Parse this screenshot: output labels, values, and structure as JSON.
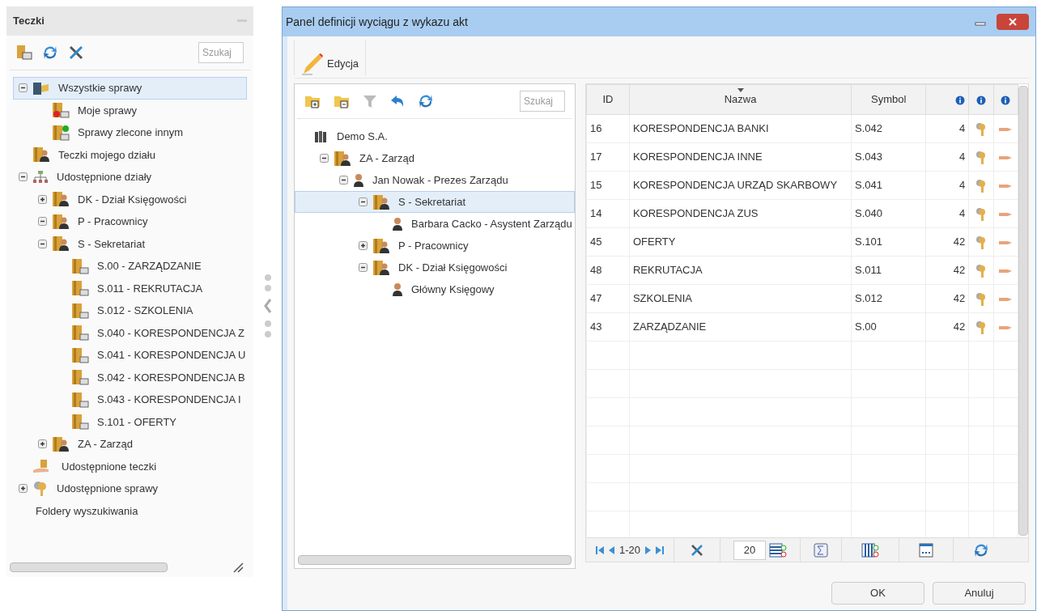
{
  "left_panel": {
    "title": "Teczki",
    "search": {
      "placeholder": "Szukaj"
    },
    "tree": [
      {
        "label": "Wszystkie sprawy",
        "kind": "cabinet",
        "expanded": true,
        "selected": true,
        "children": [
          {
            "label": "Moje sprawy",
            "kind": "case-alert",
            "selected": false
          },
          {
            "label": "Sprawy zlecone innym",
            "kind": "case-add",
            "selected": false
          }
        ]
      },
      {
        "label": "Teczki mojego działu",
        "kind": "dept",
        "selected": false
      },
      {
        "label": "Udostępnione działy",
        "kind": "org",
        "expanded": true,
        "selected": false,
        "children": [
          {
            "label": "DK - Dział Księgowości",
            "kind": "dept",
            "expanded": false,
            "selected": false
          },
          {
            "label": "P - Pracownicy",
            "kind": "dept",
            "expanded": true,
            "selected": false
          },
          {
            "label": "S - Sekretariat",
            "kind": "dept",
            "expanded": true,
            "selected": false,
            "children": [
              {
                "label": "S.00 - ZARZĄDZANIE",
                "kind": "folder",
                "selected": false
              },
              {
                "label": "S.011 - REKRUTACJA",
                "kind": "folder",
                "selected": false
              },
              {
                "label": "S.012 - SZKOLENIA",
                "kind": "folder",
                "selected": false
              },
              {
                "label": "S.040 - KORESPONDENCJA Z",
                "kind": "folder",
                "selected": false
              },
              {
                "label": "S.041 - KORESPONDENCJA U",
                "kind": "folder",
                "selected": false
              },
              {
                "label": "S.042 - KORESPONDENCJA B",
                "kind": "folder",
                "selected": false
              },
              {
                "label": "S.043 - KORESPONDENCJA I",
                "kind": "folder",
                "selected": false
              },
              {
                "label": "S.101 - OFERTY",
                "kind": "folder",
                "selected": false
              }
            ]
          },
          {
            "label": "ZA - Zarząd",
            "kind": "dept",
            "expanded": false,
            "selected": false
          }
        ]
      },
      {
        "label": "Udostępnione teczki",
        "kind": "shared",
        "selected": false
      },
      {
        "label": "Udostępnione sprawy",
        "kind": "keys",
        "expanded": false,
        "selected": false
      },
      {
        "label": "Foldery wyszukiwania",
        "kind": "search-folder",
        "selected": false
      }
    ]
  },
  "dialog": {
    "title": "Panel definicji wyciągu z wykazu akt",
    "toolbar": [
      {
        "label": "Edycja"
      }
    ],
    "tree_panel": {
      "search": {
        "placeholder": "Szukaj"
      },
      "tree": [
        {
          "label": "Demo S.A.",
          "kind": "root",
          "selected": false,
          "children": [
            {
              "label": "ZA - Zarząd",
              "kind": "dept",
              "expanded": true,
              "selected": false,
              "children": [
                {
                  "label": "Jan Nowak - Prezes Zarządu",
                  "kind": "person",
                  "expanded": true,
                  "selected": false,
                  "children": [
                    {
                      "label": "S - Sekretariat",
                      "kind": "dept",
                      "expanded": true,
                      "selected": true,
                      "children": [
                        {
                          "label": "Barbara Cacko - Asystent Zarządu",
                          "kind": "person",
                          "selected": false
                        }
                      ]
                    },
                    {
                      "label": "P - Pracownicy",
                      "kind": "dept",
                      "expanded": false,
                      "selected": false
                    },
                    {
                      "label": "DK - Dział Księgowości",
                      "kind": "dept",
                      "expanded": true,
                      "selected": false,
                      "children": [
                        {
                          "label": "Główny Księgowy",
                          "kind": "person",
                          "selected": false
                        }
                      ]
                    }
                  ]
                }
              ]
            }
          ]
        }
      ]
    },
    "grid": {
      "columns": [
        {
          "kind": "text",
          "label": "ID"
        },
        {
          "kind": "text",
          "label": "Nazwa",
          "sorted": true
        },
        {
          "kind": "text",
          "label": "Symbol"
        },
        {
          "kind": "info"
        },
        {
          "kind": "info"
        },
        {
          "kind": "info"
        }
      ],
      "rows": [
        {
          "id": "16",
          "name": "KORESPONDENCJA BANKI",
          "symbol": "S.042",
          "count": "4"
        },
        {
          "id": "17",
          "name": "KORESPONDENCJA INNE",
          "symbol": "S.043",
          "count": "4"
        },
        {
          "id": "15",
          "name": "KORESPONDENCJA URZĄD SKARBOWY",
          "symbol": "S.041",
          "count": "4"
        },
        {
          "id": "14",
          "name": "KORESPONDENCJA ZUS",
          "symbol": "S.040",
          "count": "4"
        },
        {
          "id": "45",
          "name": "OFERTY",
          "symbol": "S.101",
          "count": "42"
        },
        {
          "id": "48",
          "name": "REKRUTACJA",
          "symbol": "S.011",
          "count": "42"
        },
        {
          "id": "47",
          "name": "SZKOLENIA",
          "symbol": "S.012",
          "count": "42"
        },
        {
          "id": "43",
          "name": "ZARZĄDZANIE",
          "symbol": "S.00",
          "count": "42"
        }
      ],
      "pager": {
        "range": "1-20",
        "page_size": "20"
      }
    },
    "buttons": [
      "OK",
      "Anuluj"
    ]
  }
}
